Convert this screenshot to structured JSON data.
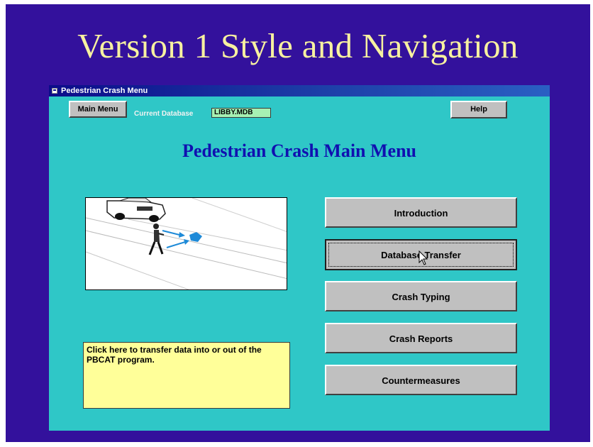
{
  "slide": {
    "title": "Version 1 Style and Navigation"
  },
  "window": {
    "title": "Pedestrian Crash Menu"
  },
  "toolbar": {
    "main_menu_label": "Main Menu",
    "current_database_label": "Current Database",
    "current_database_value": "LIBBY.MDB",
    "help_label": "Help"
  },
  "main": {
    "heading": "Pedestrian Crash Main Menu",
    "illustration_icon": "pedestrian-crossing-illustration",
    "status_text": "Click here to transfer data into or out of the PBCAT program.",
    "buttons": [
      {
        "label": "Introduction",
        "focused": false
      },
      {
        "label": "Database Transfer",
        "focused": true
      },
      {
        "label": "Crash Typing",
        "focused": false
      },
      {
        "label": "Crash Reports",
        "focused": false
      },
      {
        "label": "Countermeasures",
        "focused": false
      }
    ]
  },
  "colors": {
    "slide_background": "#33119c",
    "slide_title": "#f7f1a0",
    "window_background": "#2fc7c7",
    "heading": "#1010b0",
    "database_field": "#a6f1b3",
    "status_box": "#ffff99",
    "button_face": "#c0c0c0"
  }
}
